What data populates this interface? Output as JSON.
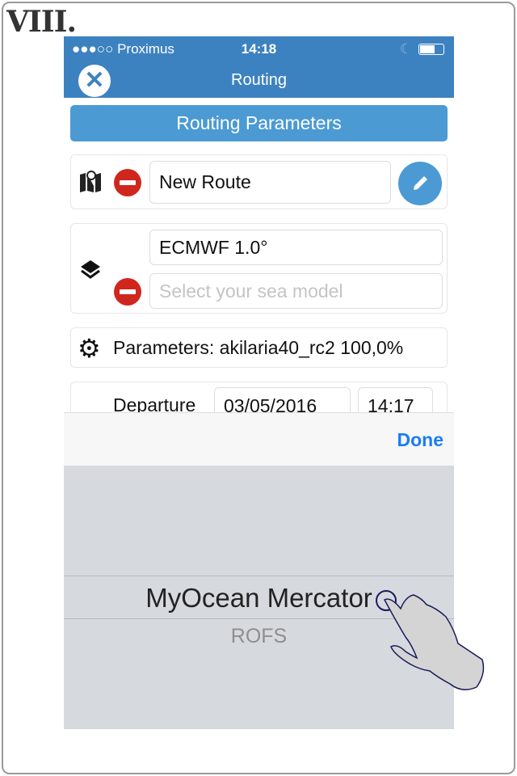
{
  "step_label": "VIII.",
  "status_bar": {
    "carrier": "●●●○○ Proximus",
    "time": "14:18"
  },
  "nav": {
    "title": "Routing"
  },
  "routing_parameters_label": "Routing Parameters",
  "route": {
    "name": "New Route"
  },
  "weather": {
    "model": "ECMWF 1.0°",
    "sea_placeholder": "Select your sea model"
  },
  "parameters": {
    "text": "Parameters: akilaria40_rc2 100,0%"
  },
  "departure": {
    "label": "Departure",
    "date": "03/05/2016",
    "time": "14:17"
  },
  "picker": {
    "done_label": "Done",
    "selected": "MyOcean Mercator",
    "next": "ROFS"
  },
  "colors": {
    "nav": "#3d82c0",
    "accent": "#4b9ad4",
    "remove": "#d0261e",
    "done": "#1a7cf5"
  }
}
